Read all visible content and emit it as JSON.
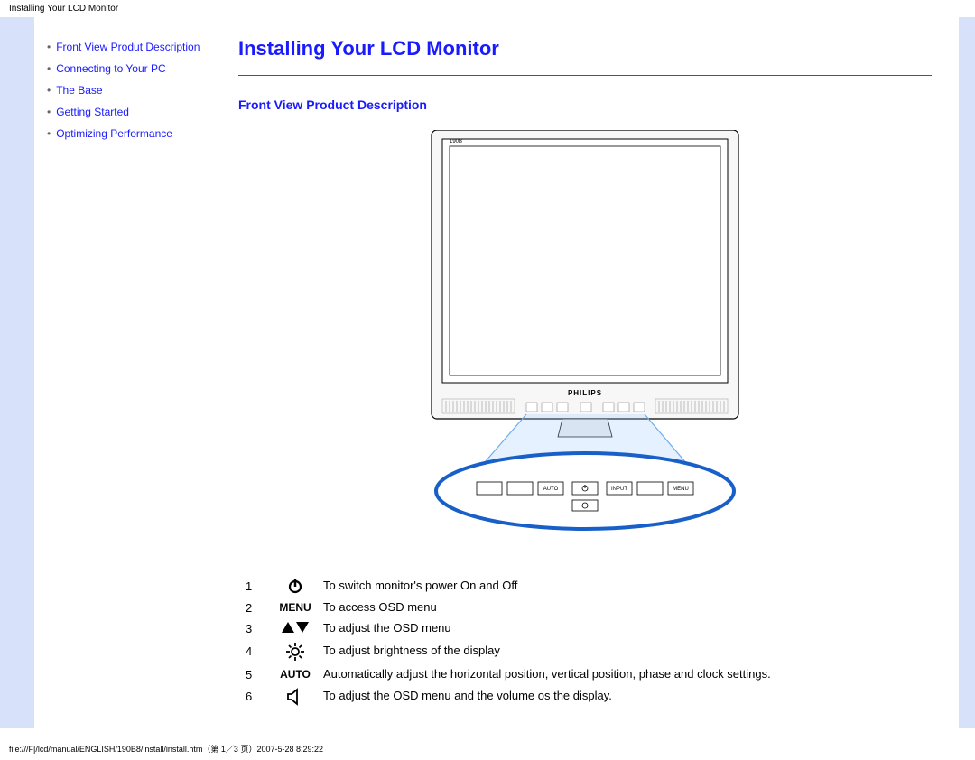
{
  "header_title": "Installing Your LCD Monitor",
  "sidebar": {
    "items": [
      {
        "label": "Front View Produt Description"
      },
      {
        "label": "Connecting to Your PC"
      },
      {
        "label": "The Base"
      },
      {
        "label": "Getting Started"
      },
      {
        "label": "Optimizing Performance"
      }
    ]
  },
  "main": {
    "title": "Installing Your LCD Monitor",
    "section_heading": "Front View Product Description",
    "monitor_brand": "PHILIPS",
    "monitor_model": "190B",
    "buttons": [
      "",
      "",
      "AUTO",
      "",
      "INPUT",
      "",
      "MENU"
    ],
    "legend": [
      {
        "num": "1",
        "icon_type": "power",
        "label": "",
        "desc": "To switch monitor's power On and Off"
      },
      {
        "num": "2",
        "icon_type": "text",
        "label": "MENU",
        "desc": "To access OSD menu"
      },
      {
        "num": "3",
        "icon_type": "arrows",
        "label": "",
        "desc": "To adjust the OSD menu"
      },
      {
        "num": "4",
        "icon_type": "bright",
        "label": "",
        "desc": "To adjust brightness of the display"
      },
      {
        "num": "5",
        "icon_type": "text",
        "label": "AUTO",
        "desc": "Automatically adjust the horizontal position, vertical position, phase and clock settings."
      },
      {
        "num": "6",
        "icon_type": "volume",
        "label": "",
        "desc": "To adjust the OSD menu and the volume os the display."
      }
    ]
  },
  "footer_path": "file:///F|/lcd/manual/ENGLISH/190B8/install/install.htm（第 1／3 页）2007-5-28 8:29:22"
}
